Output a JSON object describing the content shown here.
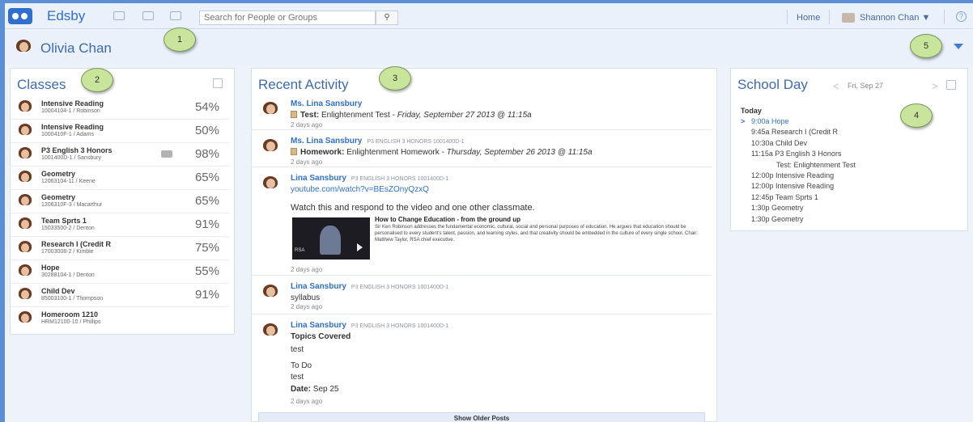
{
  "topbar": {
    "brand": "Edsby",
    "search_placeholder": "Search for People or Groups",
    "search_icon": "search-icon",
    "home": "Home",
    "user_name": "Shannon Chan ▼",
    "help_icon": "help-icon"
  },
  "profile": {
    "name": "Olivia Chan"
  },
  "callouts": [
    "1",
    "2",
    "3",
    "4",
    "5"
  ],
  "classes": {
    "title": "Classes",
    "items": [
      {
        "name": "Intensive Reading",
        "code": "10004104-1 / Robinson",
        "grade": "54%"
      },
      {
        "name": "Intensive Reading",
        "code": "1000410F-1 / Adams",
        "grade": "50%"
      },
      {
        "name": "P3 English 3 Honors",
        "code": "1001400D-1 / Sansbury",
        "grade": "98%"
      },
      {
        "name": "Geometry",
        "code": "12063104-11 / Keene",
        "grade": "65%"
      },
      {
        "name": "Geometry",
        "code": "1206310F-3 / Macarthur",
        "grade": "65%"
      },
      {
        "name": "Team Sprts 1",
        "code": "15033500-2 / Denton",
        "grade": "91%"
      },
      {
        "name": "Research I (Credit R",
        "code": "17003008-2 / Kimble",
        "grade": "75%"
      },
      {
        "name": "Hope",
        "code": "30288104-1 / Denton",
        "grade": "55%"
      },
      {
        "name": "Child Dev",
        "code": "85003100-1 / Thompson",
        "grade": "91%"
      },
      {
        "name": "Homeroom 1210",
        "code": "HRM12100-10 / Phillips",
        "grade": ""
      }
    ]
  },
  "activity": {
    "title": "Recent Activity",
    "posts": [
      {
        "author": "Ms. Lina Sansbury",
        "class": "",
        "kind": "Test:",
        "text": "Enlightenment Test -",
        "date": "Friday, September 27 2013 @ 11:15a",
        "time": "2 days ago"
      },
      {
        "author": "Ms. Lina Sansbury",
        "class": "P3 ENGLISH 3 HONORS 1001400D-1",
        "kind": "Homework:",
        "text": "Enlightenment Homework -",
        "date": "Thursday, September 26 2013 @ 11:15a",
        "time": "2 days ago"
      },
      {
        "author": "Lina Sansbury",
        "class": "P3 ENGLISH 3 HONORS 1001400D-1",
        "link": "youtube.com/watch?v=BEsZOnyQzxQ",
        "message": "Watch this and respond to the video and one other classmate.",
        "video_title": "How to Change Education - from the ground up",
        "video_desc": "Sir Ken Robinson addresses the fundamental economic, cultural, social and personal purposes of education. He argues that education should be personalised to every student's talent, passion, and learning styles, and that creativity should be embedded in the culture of every single school. Chair: Matthew Taylor, RSA chief executive.",
        "thumb_label": "RSA",
        "time": "2 days ago"
      },
      {
        "author": "Lina Sansbury",
        "class": "P3 ENGLISH 3 HONORS 1001400D-1",
        "message": "syllabus",
        "time": "2 days ago"
      },
      {
        "author": "Lina Sansbury",
        "class": "P3 ENGLISH 3 HONORS 1001400D-1",
        "topics_label": "Topics Covered",
        "topics": "test",
        "todo_label": "To Do",
        "todo": "test",
        "date_label": "Date:",
        "date_value": "Sep 25",
        "time": "2 days ago"
      }
    ],
    "show_older": "Show Older Posts"
  },
  "school_day": {
    "title": "School Day",
    "date": "Fri, Sep 27",
    "prev": "<",
    "next": ">",
    "today": "Today",
    "items": [
      {
        "text": "9:00a Hope",
        "current": true
      },
      {
        "text": "9:45a Research I (Credit R"
      },
      {
        "text": "10:30a Child Dev"
      },
      {
        "text": "11:15a P3 English 3 Honors"
      },
      {
        "text": "Test: Enlightenment Test",
        "indent": true
      },
      {
        "text": "12:00p Intensive Reading"
      },
      {
        "text": "12:00p Intensive Reading"
      },
      {
        "text": "12:45p Team Sprts 1"
      },
      {
        "text": "1:30p Geometry"
      },
      {
        "text": "1:30p Geometry"
      }
    ],
    "current_marker": ">"
  },
  "colors": {
    "accent": "#2f6fd0",
    "callout": "#c9e49b",
    "border": "#5b8fd6"
  }
}
